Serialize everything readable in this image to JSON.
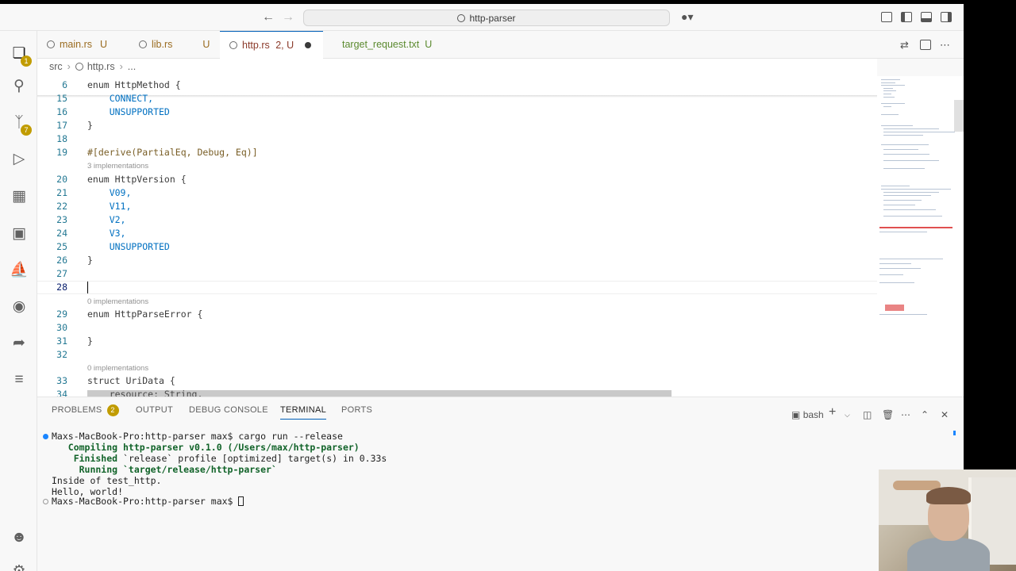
{
  "window": {
    "search_text": "http-parser"
  },
  "activity_bar": {
    "explorer_badge": "1",
    "scm_badge": "7"
  },
  "tabs": [
    {
      "label": "main.rs",
      "status": "U"
    },
    {
      "label": "lib.rs",
      "status": "U"
    },
    {
      "label": "http.rs",
      "status": "2, U",
      "dirty": true
    },
    {
      "label": "target_request.txt",
      "status": "U"
    }
  ],
  "breadcrumb": {
    "folder": "src",
    "file": "http.rs",
    "more": "..."
  },
  "editor": {
    "lines": [
      {
        "n": "6",
        "text": "enum HttpMethod {"
      },
      {
        "n": "15",
        "text": "    CONNECT,"
      },
      {
        "n": "16",
        "text": "    UNSUPPORTED"
      },
      {
        "n": "17",
        "text": "}"
      },
      {
        "n": "18",
        "text": ""
      },
      {
        "n": "19",
        "text": "#[derive(PartialEq, Debug, Eq)]"
      },
      {
        "n": "20",
        "text": "enum HttpVersion {"
      },
      {
        "n": "21",
        "text": "    V09,"
      },
      {
        "n": "22",
        "text": "    V11,"
      },
      {
        "n": "23",
        "text": "    V2,"
      },
      {
        "n": "24",
        "text": "    V3,"
      },
      {
        "n": "25",
        "text": "    UNSUPPORTED"
      },
      {
        "n": "26",
        "text": "}"
      },
      {
        "n": "27",
        "text": ""
      },
      {
        "n": "28",
        "text": ""
      },
      {
        "n": "29",
        "text": "enum HttpParseError {"
      },
      {
        "n": "30",
        "text": ""
      },
      {
        "n": "31",
        "text": "}"
      },
      {
        "n": "32",
        "text": ""
      },
      {
        "n": "33",
        "text": "struct UriData {"
      },
      {
        "n": "34",
        "text": "    resource: String,"
      }
    ],
    "hints": {
      "version": "3 implementations",
      "parse_error": "0 implementations",
      "uri_data": "0 implementations"
    }
  },
  "panel": {
    "tabs": [
      "PROBLEMS",
      "OUTPUT",
      "DEBUG CONSOLE",
      "TERMINAL",
      "PORTS"
    ],
    "problems_count": "2",
    "shell": "bash",
    "terminal_lines": [
      "Maxs-MacBook-Pro:http-parser max$ cargo run --release",
      "   Compiling http-parser v0.1.0 (/Users/max/http-parser)",
      "    Finished `release` profile [optimized] target(s) in 0.33s",
      "     Running `target/release/http-parser`",
      "Inside of test_http.",
      "Hello, world!",
      "Maxs-MacBook-Pro:http-parser max$ "
    ]
  },
  "colors": {
    "accent": "#005fb8",
    "badge": "#c19c00",
    "keyword": "#0000ff",
    "type": "#267f99",
    "line_number": "#237893"
  }
}
